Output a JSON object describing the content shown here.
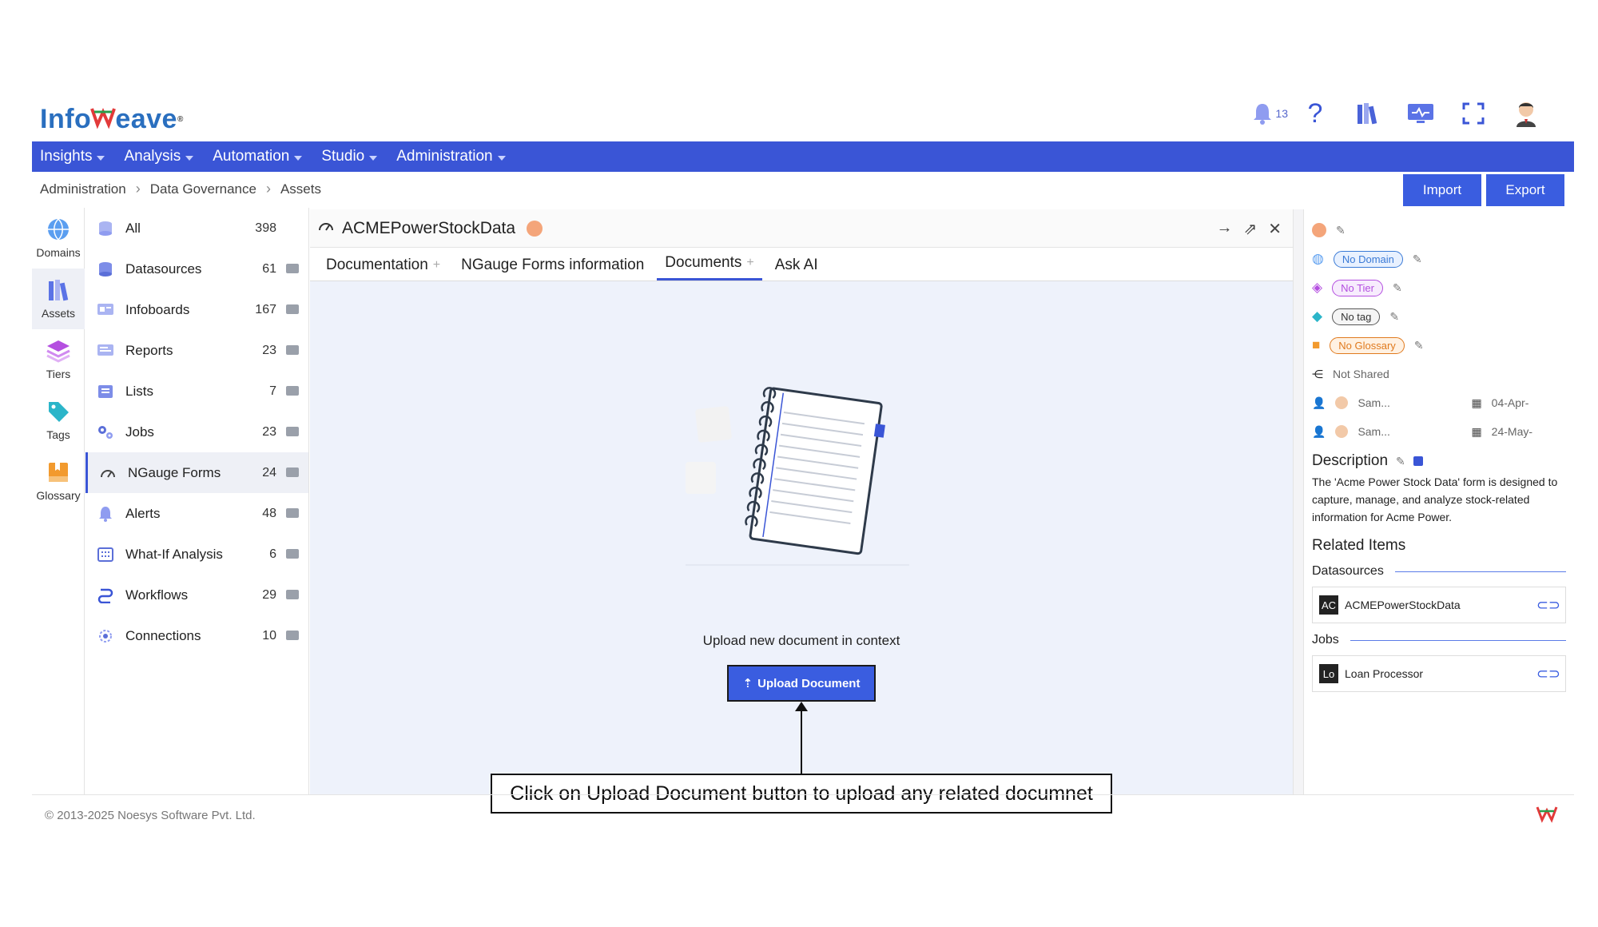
{
  "header": {
    "logo_left": "Info",
    "logo_right": "eave",
    "notifications_count": "13"
  },
  "nav": [
    {
      "label": "Insights"
    },
    {
      "label": "Analysis"
    },
    {
      "label": "Automation"
    },
    {
      "label": "Studio"
    },
    {
      "label": "Administration"
    }
  ],
  "breadcrumb": [
    "Administration",
    "Data Governance",
    "Assets"
  ],
  "actions": {
    "import": "Import",
    "export": "Export"
  },
  "rail": [
    {
      "label": "Domains",
      "icon": "globe-icon"
    },
    {
      "label": "Assets",
      "icon": "books-icon"
    },
    {
      "label": "Tiers",
      "icon": "layers-icon"
    },
    {
      "label": "Tags",
      "icon": "tag-icon"
    },
    {
      "label": "Glossary",
      "icon": "book-icon"
    }
  ],
  "categories": [
    {
      "label": "All",
      "count": "398"
    },
    {
      "label": "Datasources",
      "count": "61"
    },
    {
      "label": "Infoboards",
      "count": "167"
    },
    {
      "label": "Reports",
      "count": "23"
    },
    {
      "label": "Lists",
      "count": "7"
    },
    {
      "label": "Jobs",
      "count": "23"
    },
    {
      "label": "NGauge Forms",
      "count": "24"
    },
    {
      "label": "Alerts",
      "count": "48"
    },
    {
      "label": "What-If Analysis",
      "count": "6"
    },
    {
      "label": "Workflows",
      "count": "29"
    },
    {
      "label": "Connections",
      "count": "10"
    }
  ],
  "main": {
    "title": "ACMEPowerStockData",
    "tabs": [
      {
        "label": "Documentation"
      },
      {
        "label": "NGauge Forms information"
      },
      {
        "label": "Documents"
      },
      {
        "label": "Ask AI"
      }
    ],
    "upload_text": "Upload new document in context",
    "upload_button": "Upload Document"
  },
  "callout": "Click on Upload Document button to upload any related documnet",
  "right_panel": {
    "domain": "No Domain",
    "tier": "No Tier",
    "tag": "No tag",
    "glossary": "No Glossary",
    "shared": "Not Shared",
    "owner1": "Sam...",
    "date1": "04-Apr-",
    "owner2": "Sam...",
    "date2": "24-May-",
    "description_title": "Description",
    "description": "The 'Acme Power Stock Data' form is designed to capture, manage, and analyze stock-related information for Acme Power.",
    "related_title": "Related Items",
    "datasources_label": "Datasources",
    "datasource_abbr": "AC",
    "datasource_name": "ACMEPowerStockData",
    "jobs_label": "Jobs",
    "job_abbr": "Lo",
    "job_name": "Loan Processor"
  },
  "footer": {
    "copyright": "© 2013-2025 Noesys Software Pvt. Ltd."
  }
}
